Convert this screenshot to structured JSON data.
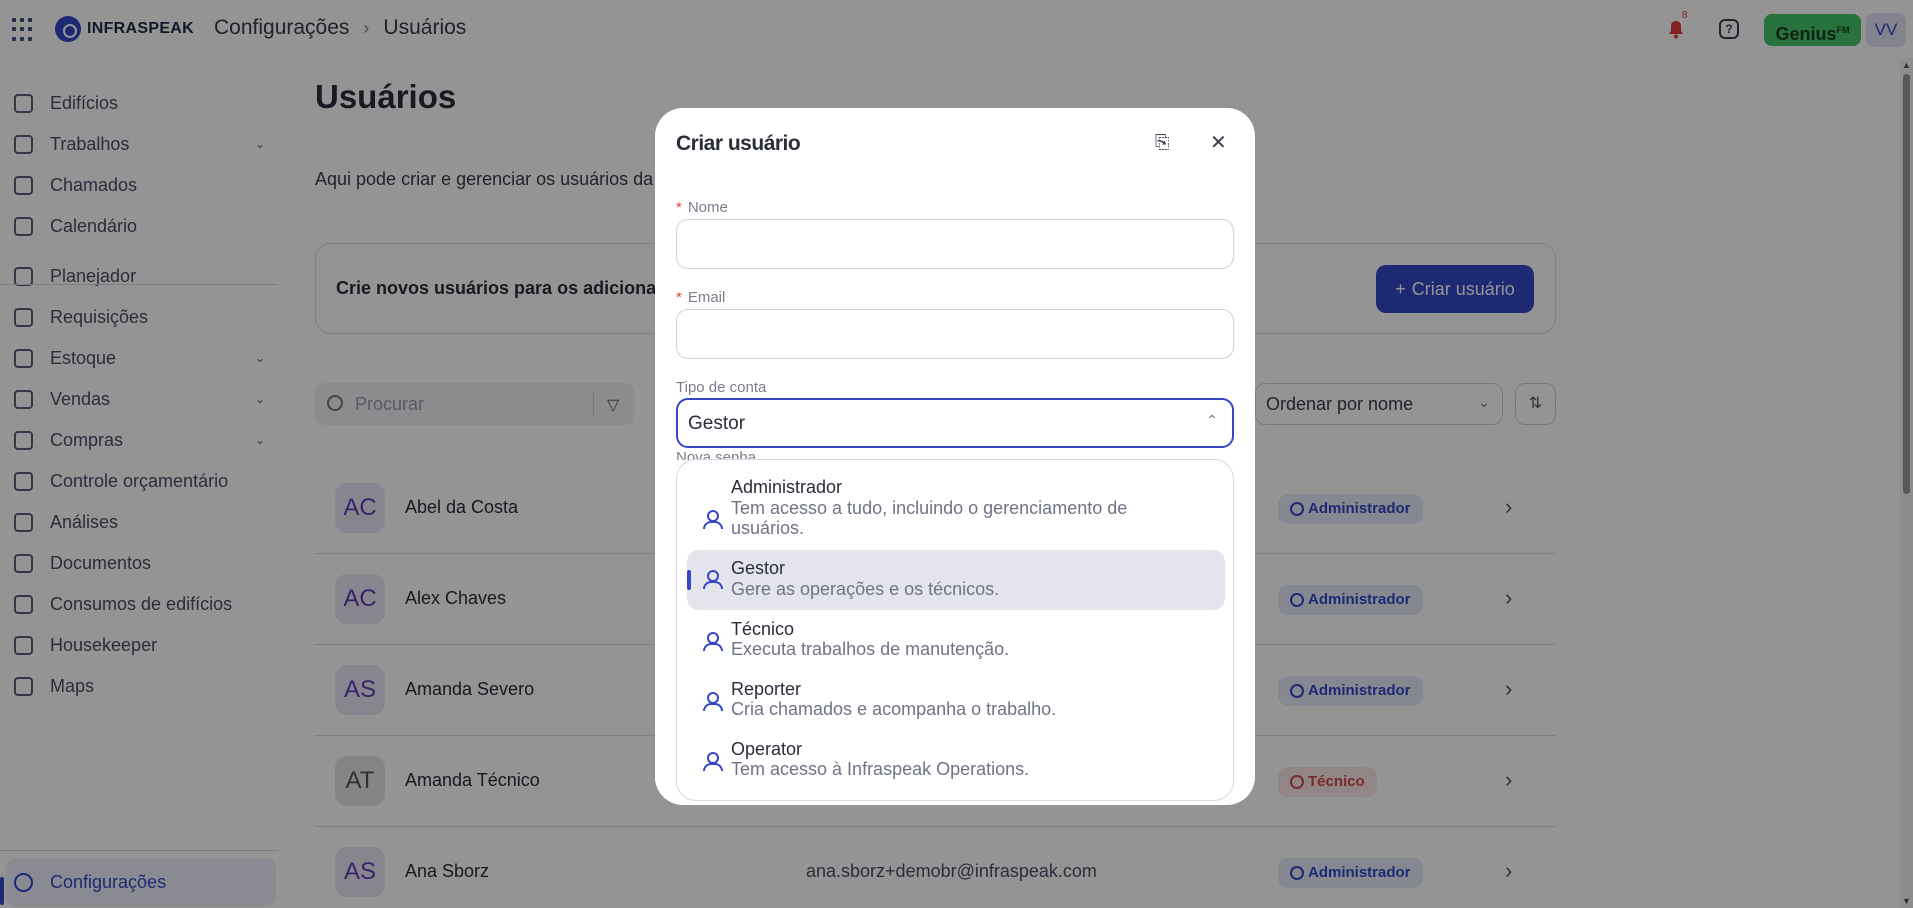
{
  "topbar": {
    "logo": "INFRASPEAK",
    "breadcrumb": [
      "Configurações",
      "Usuários"
    ],
    "notification_count": "8",
    "help_icon": "?",
    "genius_label": "Genius",
    "genius_sup": "FM",
    "user_initials": "VV"
  },
  "sidebar": {
    "items": [
      {
        "label": "Edifícios",
        "icon": "building-icon"
      },
      {
        "label": "Trabalhos",
        "icon": "calendar-icon",
        "expandable": true
      },
      {
        "label": "Chamados",
        "icon": "clipboard-icon"
      },
      {
        "label": "Calendário",
        "icon": "calendar-grid-icon"
      },
      {
        "label": "Planejador",
        "icon": "planner-icon"
      },
      {
        "label": "Requisições",
        "icon": "bell-service-icon"
      },
      {
        "label": "Estoque",
        "icon": "stock-icon",
        "expandable": true
      },
      {
        "label": "Vendas",
        "icon": "tag-icon",
        "expandable": true
      },
      {
        "label": "Compras",
        "icon": "cart-icon",
        "expandable": true
      },
      {
        "label": "Controle orçamentário",
        "icon": "budget-icon"
      },
      {
        "label": "Análises",
        "icon": "chart-icon"
      },
      {
        "label": "Documentos",
        "icon": "document-icon"
      },
      {
        "label": "Consumos de edifícios",
        "icon": "lightning-icon"
      },
      {
        "label": "Housekeeper",
        "icon": "housekeeper-icon"
      },
      {
        "label": "Maps",
        "icon": "map-pin-icon"
      },
      {
        "label": "Configurações",
        "icon": "gear-icon",
        "active": true
      }
    ]
  },
  "main": {
    "title": "Usuários",
    "description": "Aqui pode criar e gerenciar os usuários da",
    "banner_text": "Crie novos usuários para os adicionar a",
    "create_button": "Criar usuário",
    "search_placeholder": "Procurar",
    "sort_label": "Ordenar por nome",
    "users": [
      {
        "initials": "AC",
        "name": "Abel da Costa",
        "email": "",
        "role": "Administrador"
      },
      {
        "initials": "AC",
        "name": "Alex Chaves",
        "email": "",
        "role": "Administrador"
      },
      {
        "initials": "AS",
        "name": "Amanda Severo",
        "email": "",
        "role": "Administrador"
      },
      {
        "initials": "AT",
        "name": "Amanda Técnico",
        "email": "",
        "role": "Técnico"
      },
      {
        "initials": "AS",
        "name": "Ana Sborz",
        "email": "ana.sborz+demobr@infraspeak.com",
        "role": "Administrador"
      }
    ]
  },
  "modal": {
    "title": "Criar usuário",
    "name_label": "Nome",
    "email_label": "Email",
    "account_type_label": "Tipo de conta",
    "account_type_value": "Gestor",
    "password_label": "Nova senha",
    "options": [
      {
        "title": "Administrador",
        "description": "Tem acesso a tudo, incluindo o gerenciamento de usuários.",
        "description_line1": "Tem acesso a tudo, incluindo o gerenciamento de",
        "description_line2": "usuários.",
        "selected": false
      },
      {
        "title": "Gestor",
        "description": "Gere as operações e os técnicos.",
        "selected": true
      },
      {
        "title": "Técnico",
        "description": "Executa trabalhos de manutenção.",
        "selected": false
      },
      {
        "title": "Reporter",
        "description": "Cria chamados e acompanha o trabalho.",
        "selected": false
      },
      {
        "title": "Operator",
        "description": "Tem acesso à Infraspeak Operations.",
        "selected": false
      }
    ]
  },
  "colors": {
    "brand": "#3547c7",
    "genius": "#46c46a",
    "admin_badge": "#e5e8fa",
    "tech_badge": "#fbe6e6"
  }
}
